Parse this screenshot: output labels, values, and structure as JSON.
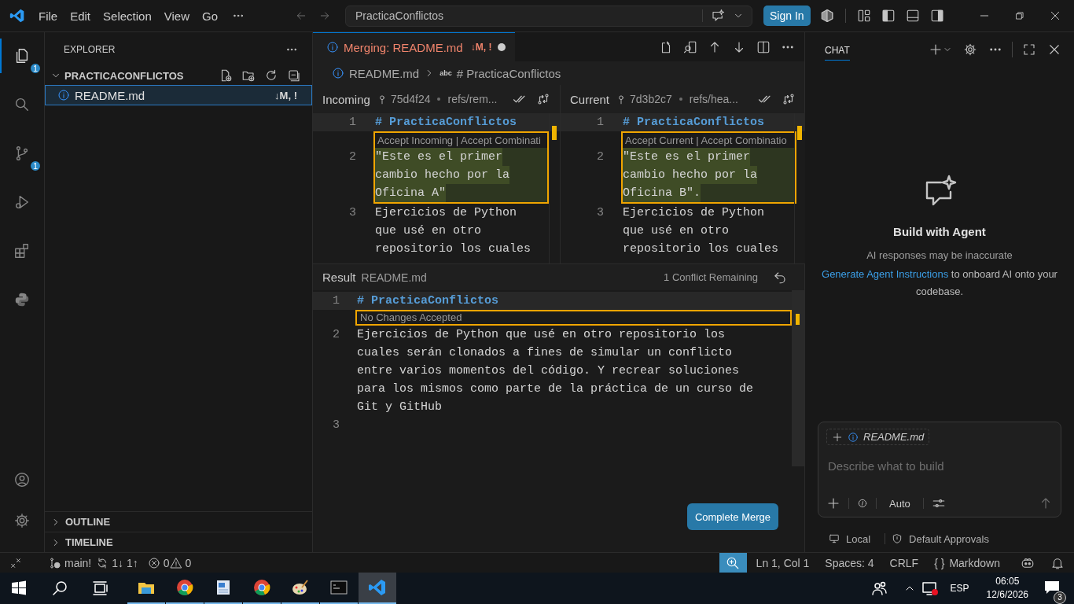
{
  "title_bar": {
    "menus": [
      "File",
      "Edit",
      "Selection",
      "View",
      "Go"
    ],
    "search": "PracticaConflictos",
    "sign_in": "Sign In"
  },
  "activity_bar": [
    {
      "kind": "explorer",
      "badge": "1",
      "selected": true
    },
    {
      "kind": "search",
      "selected": false
    },
    {
      "kind": "source-control",
      "badge": "1",
      "selected": false
    },
    {
      "kind": "run",
      "selected": false
    },
    {
      "kind": "extensions",
      "selected": false
    },
    {
      "kind": "python",
      "selected": false
    }
  ],
  "sidebar": {
    "title": "EXPLORER",
    "folder": {
      "name": "PRACTICACONFLICTOS",
      "expanded": true
    },
    "files": [
      {
        "name": "README.md",
        "status": "↓M, !",
        "selected": true
      }
    ],
    "sections": [
      {
        "name": "OUTLINE",
        "expanded": false
      },
      {
        "name": "TIMELINE",
        "expanded": false
      }
    ]
  },
  "editor": {
    "tab": {
      "label": "Merging: README.md",
      "status": "↓M, !",
      "dirty": true
    },
    "breadcrumb": {
      "file": "README.md",
      "symbol_icon": "abc",
      "symbol": "# PracticaConflictos"
    },
    "panes": [
      {
        "title": "Incoming",
        "commit": "75d4f24",
        "ref": "refs/rem...",
        "lines": [
          {
            "number": "1",
            "kind": "heading",
            "segments": [
              "# PracticaConflictos"
            ]
          },
          {
            "number": "2",
            "kind": "conflict",
            "actions": "Accept Incoming | Accept Combinati",
            "segments": [
              "\"Este es el primer",
              "cambio hecho por la",
              "Oficina A\""
            ]
          },
          {
            "number": "3",
            "kind": "plain",
            "segments": [
              "Ejercicios de Python",
              "que usé en otro",
              "repositorio los cuales"
            ]
          }
        ]
      },
      {
        "title": "Current",
        "commit": "7d3b2c7",
        "ref": "refs/hea...",
        "lines": [
          {
            "number": "1",
            "kind": "heading",
            "segments": [
              "# PracticaConflictos"
            ]
          },
          {
            "number": "2",
            "kind": "conflict",
            "actions": "Accept Current | Accept Combinatio",
            "segments": [
              "\"Este es el primer",
              "cambio hecho por la",
              "Oficina B\"."
            ]
          },
          {
            "number": "3",
            "kind": "plain",
            "segments": [
              "Ejercicios de Python",
              "que usé en otro",
              "repositorio los cuales"
            ]
          }
        ]
      }
    ],
    "result": {
      "title": "Result",
      "file": "README.md",
      "remaining": "1 Conflict Remaining",
      "lines": [
        {
          "number": "1",
          "kind": "heading",
          "segments": [
            "# PracticaConflictos"
          ]
        },
        {
          "kind": "lens",
          "text": "No Changes Accepted"
        },
        {
          "number": "2",
          "kind": "plain",
          "segments": [
            "Ejercicios de Python que usé en otro repositorio los",
            "cuales serán clonados a fines de simular un conflicto",
            "entre varios momentos del código. Y recrear soluciones",
            "para los mismos como parte de la práctica de un curso de",
            "Git y GitHub"
          ]
        },
        {
          "number": "3",
          "kind": "plain"
        }
      ]
    },
    "complete_button": "Complete Merge"
  },
  "chat": {
    "tab": {
      "label": "CHAT",
      "selected": true
    },
    "title": "Build with Agent",
    "note": "AI responses may be inaccurate",
    "hint": {
      "link": "Generate Agent Instructions",
      "text": " to onboard AI onto your codebase."
    },
    "attachment": "README.md",
    "input": {
      "placeholder": "Describe what to build"
    },
    "mode": "Auto",
    "footer": [
      "Local",
      "Default Approvals"
    ]
  },
  "status_bar": {
    "branch": "main!",
    "sync": "1↓ 1↑",
    "errors": "0",
    "warnings": "0",
    "position": "Ln 1, Col 1",
    "spaces": "Spaces: 4",
    "eol": "CRLF",
    "language_icon": "{ }",
    "language": "Markdown"
  },
  "taskbar": {
    "apps": [
      {
        "kind": "files",
        "selected": false
      },
      {
        "kind": "browser",
        "selected": false
      },
      {
        "kind": "document",
        "selected": false
      },
      {
        "kind": "browser",
        "selected": false
      },
      {
        "kind": "paint",
        "selected": false
      },
      {
        "kind": "terminal",
        "selected": false
      },
      {
        "kind": "code",
        "selected": true
      }
    ],
    "language": "ESP",
    "time": "06:05",
    "date": "12/6/2026",
    "notifications": "3"
  }
}
